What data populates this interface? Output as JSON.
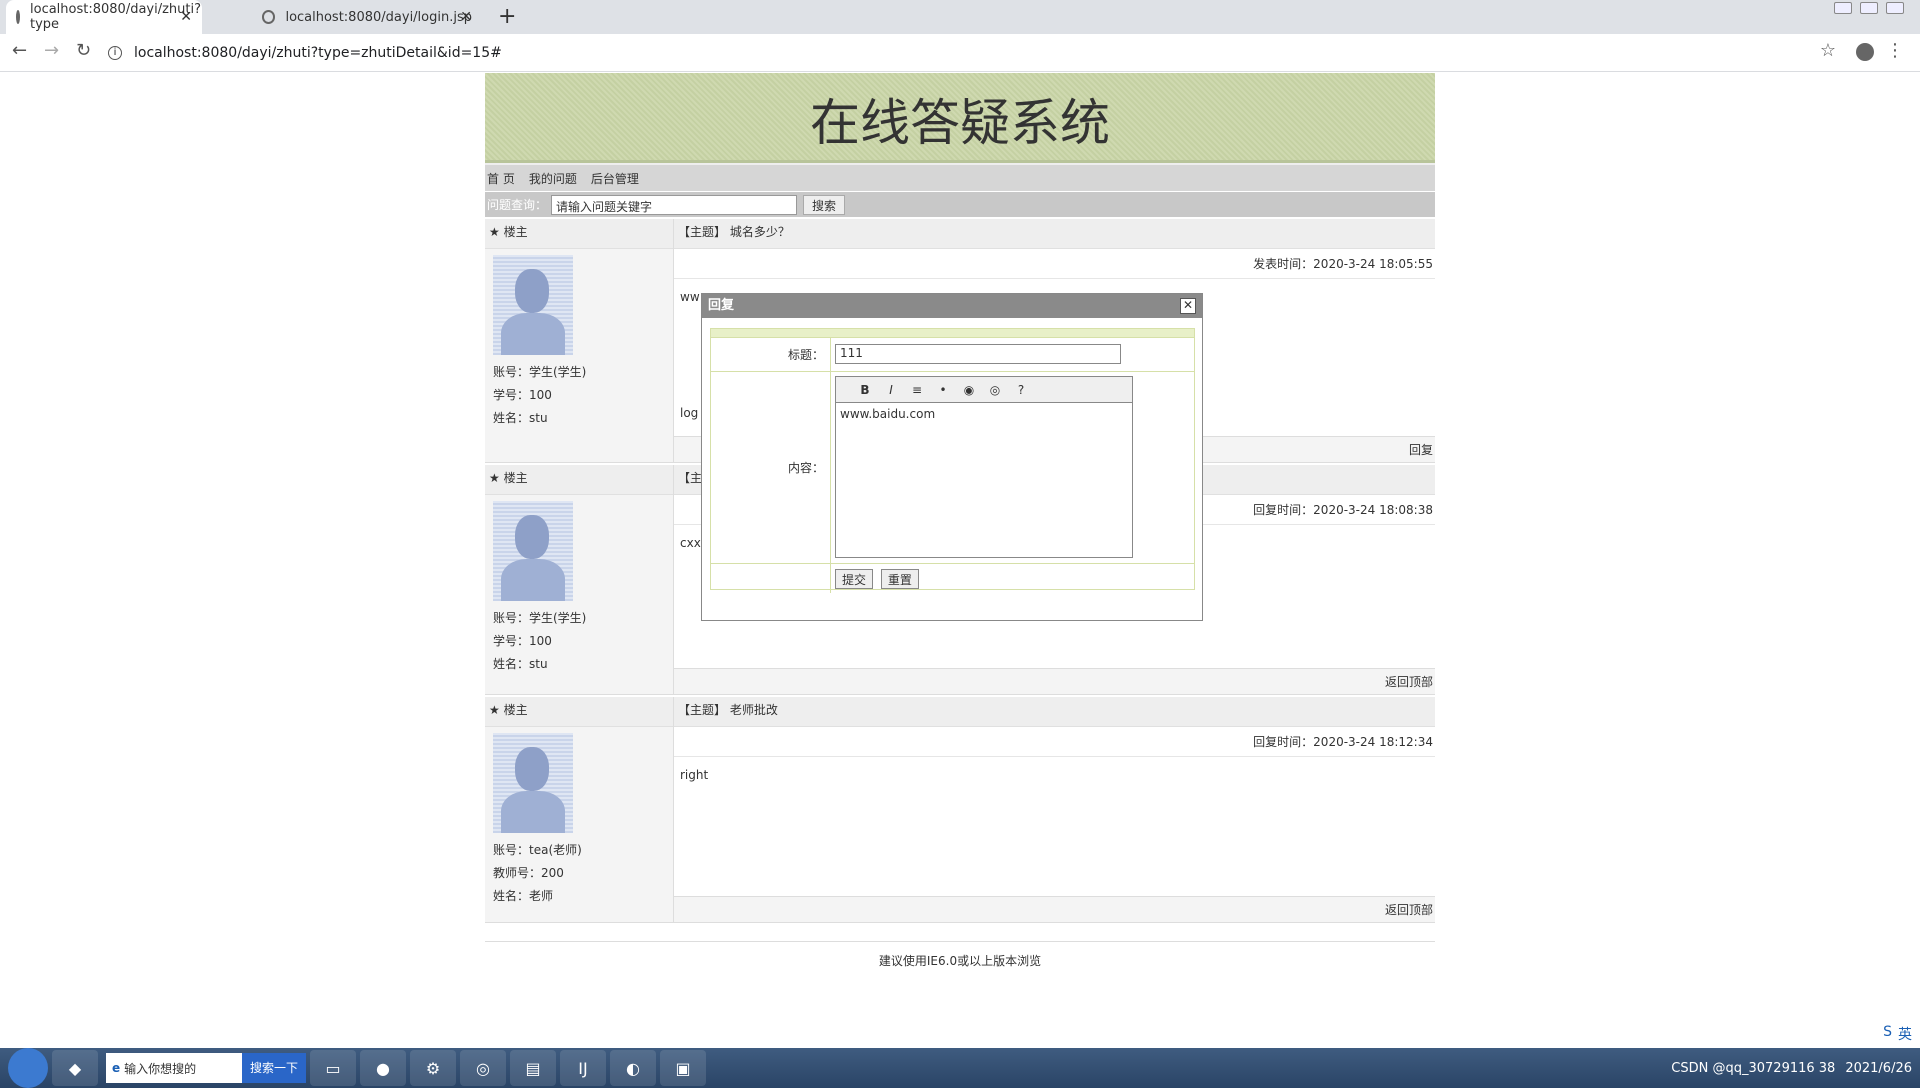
{
  "browser": {
    "tabs": [
      {
        "title": "localhost:8080/dayi/zhuti?type",
        "active": true
      },
      {
        "title": "localhost:8080/dayi/login.jsp",
        "active": false
      }
    ],
    "url": "localhost:8080/dayi/zhuti?type=zhutiDetail&id=15#"
  },
  "site": {
    "title": "在线答疑系统",
    "nav": [
      "首 页",
      "我的问题",
      "后台管理"
    ],
    "search_label": "问题查询：",
    "search_placeholder": "请输入问题关键字",
    "search_button": "搜索",
    "footer": "建议使用IE6.0或以上版本浏览"
  },
  "posts": [
    {
      "role": "★ 楼主",
      "account": "账号：学生(学生)",
      "idline": "学号：100",
      "name": "姓名：stu",
      "subject": "【主题】 城名多少？",
      "time": "发表时间：2020-3-24 18:05:55",
      "content": "ww",
      "content2": "log",
      "action": "回复"
    },
    {
      "role": "★ 楼主",
      "account": "账号：学生(学生)",
      "idline": "学号：100",
      "name": "姓名：stu",
      "subject": "【主",
      "time": "回复时间：2020-3-24 18:08:38",
      "content": "cxx",
      "content2": "",
      "action": "返回顶部"
    },
    {
      "role": "★ 楼主",
      "account": "账号：tea(老师)",
      "idline": "教师号：200",
      "name": "姓名：老师",
      "subject": "【主题】 老师批改",
      "time": "回复时间：2020-3-24 18:12:34",
      "content": "right",
      "content2": "",
      "action": "返回顶部"
    }
  ],
  "dialog": {
    "title": "回复",
    "label_title": "标题：",
    "title_value": "111",
    "label_content": "内容：",
    "content_value": "www.baidu.com",
    "submit": "提交",
    "reset": "重置",
    "toolbar": [
      "B",
      "I",
      "≡",
      "•",
      "◉",
      "◎",
      "?"
    ]
  },
  "taskbar": {
    "search_text": "输入你想搜的",
    "search_button": "搜索一下",
    "tray_text": "CSDN @qq_30729116 38",
    "tray_date": "2021/6/26",
    "ime": "英"
  }
}
